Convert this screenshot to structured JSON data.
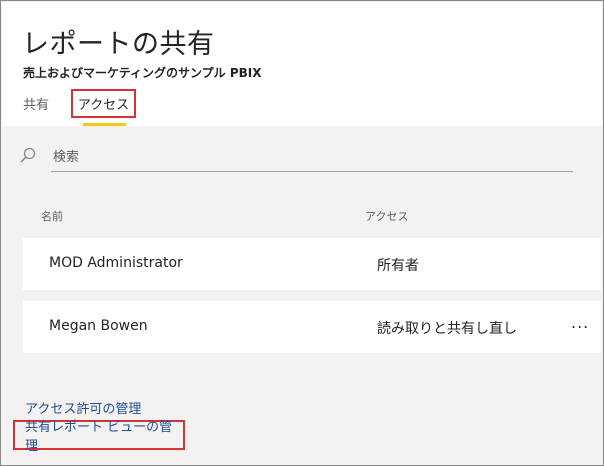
{
  "header": {
    "title": "レポートの共有",
    "subtitle": "売上およびマーケティングのサンプル PBIX"
  },
  "tabs": {
    "share": "共有",
    "access": "アクセス"
  },
  "search": {
    "placeholder": "検索"
  },
  "table": {
    "columns": {
      "name": "名前",
      "access": "アクセス"
    },
    "rows": [
      {
        "name": "MOD Administrator",
        "access": "所有者"
      },
      {
        "name": "Megan Bowen",
        "access": "読み取りと共有し直し",
        "more": "..."
      }
    ]
  },
  "links": {
    "manage_permissions": "アクセス許可の管理",
    "manage_shared_views": "共有レポート ビューの管理"
  },
  "colors": {
    "highlight_border": "#d13438",
    "tab_underline": "#f2c811",
    "link": "#1e4e9a"
  }
}
